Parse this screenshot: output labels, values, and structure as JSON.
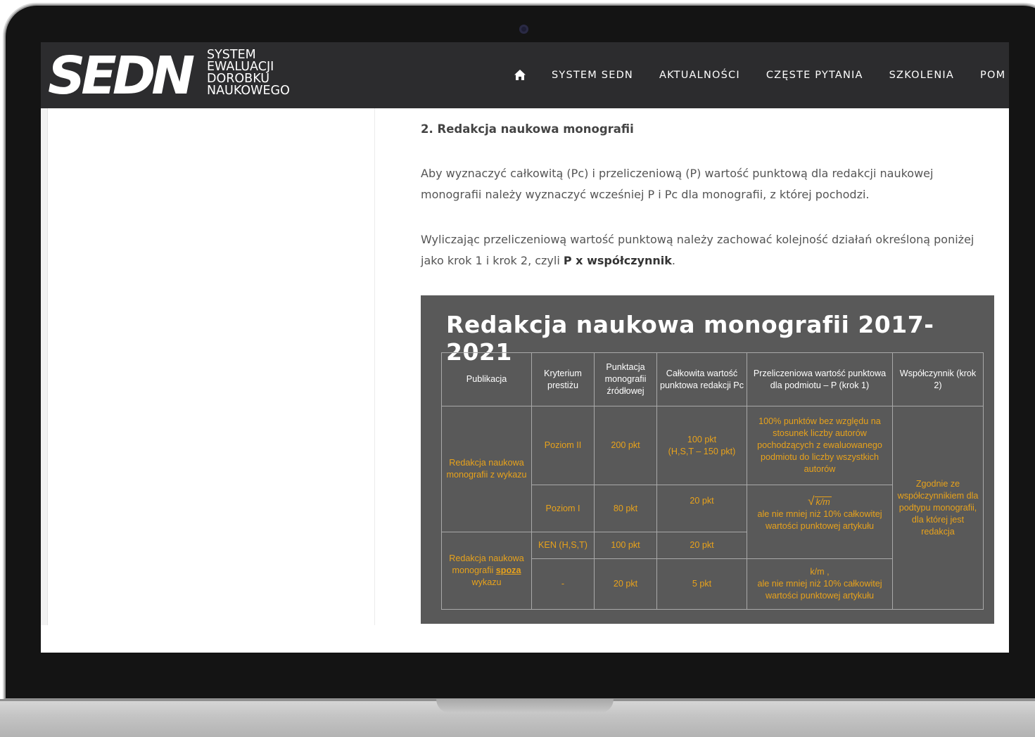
{
  "header": {
    "logo_mark": "SEDN",
    "logo_lines": [
      "SYSTEM",
      "EWALUACJI",
      "DOROBKU",
      "NAUKOWEGO"
    ],
    "nav": [
      "SYSTEM SEDN",
      "AKTUALNOŚCI",
      "CZĘSTE PYTANIA",
      "SZKOLENIA",
      "POM"
    ]
  },
  "icons": {
    "home": "home-icon"
  },
  "article": {
    "section_title": "2. Redakcja naukowa monografii",
    "para1": "Aby wyznaczyć całkowitą (Pc) i przeliczeniową (P) wartość punktową dla redakcji naukowej monografii należy wyznaczyć wcześniej P i Pc dla monografii, z której pochodzi.",
    "para2_prefix": "Wyliczając przeliczeniową wartość punktową należy zachować kolejność działań określoną poniżej jako krok 1 i krok 2, czyli ",
    "para2_bold": "P x współczynnik",
    "para2_suffix": "."
  },
  "slide": {
    "title": "Redakcja naukowa monografii 2017-2021",
    "headers": [
      "Publikacja",
      "Kryterium prestiżu",
      "Punktacja monografii źródłowej",
      "Całkowita wartość punktowa redakcji Pc",
      "Przeliczeniowa wartość punktowa dla podmiotu – P (krok 1)",
      "Współczynnik (krok 2)"
    ],
    "pub_1": "Redakcja naukowa monografii z wykazu",
    "pub_2_prefix": "Redakcja naukowa monografii ",
    "pub_2_underlined": "spoza",
    "pub_2_suffix": " wykazu",
    "rows": [
      {
        "criterion": "Poziom II",
        "source_points": "200 pkt",
        "pc_line1": "100 pkt",
        "pc_line2": "(H,S,T – 150 pkt)"
      },
      {
        "criterion": "Poziom I",
        "source_points": "80 pkt",
        "pc": "20 pkt"
      },
      {
        "criterion": "KEN (H,S,T)",
        "source_points": "100 pkt",
        "pc": "20 pkt"
      },
      {
        "criterion": "-",
        "source_points": "20 pkt",
        "pc": "5 pkt"
      }
    ],
    "p_row1": "100% punktów bez względu na stosunek liczby autorów pochodzących z ewaluowanego podmiotu do liczby wszystkich autorów",
    "p_rows23_formula": "k/m",
    "p_rows23_text": "ale nie mniej niż 10% całkowitej wartości punktowej artykułu",
    "p_row4_formula": "k/m ,",
    "p_row4_text": "ale nie mniej niż 10% całkowitej wartości punktowej artykułu",
    "coefficient": "Zgodnie ze współczynnikiem dla podtypu monografii, dla której jest redakcja"
  },
  "colors": {
    "header_bg": "#2c2c2e",
    "slide_bg": "#595959",
    "accent_orange": "#e8a21b"
  }
}
